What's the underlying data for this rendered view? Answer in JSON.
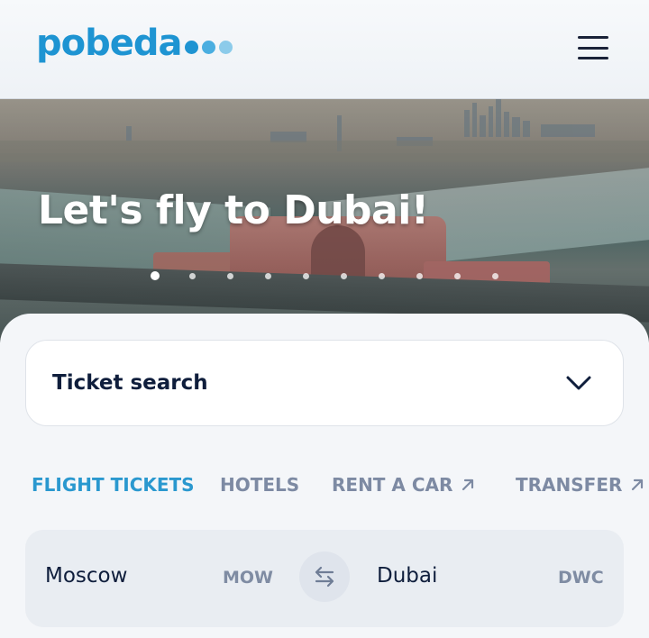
{
  "brand": {
    "name": "pobeda",
    "accent_color": "#1e94d2",
    "dot_colors": [
      "#1e94d2",
      "#4aaee0",
      "#8ccbea"
    ]
  },
  "header": {
    "menu_icon": "hamburger-menu-icon"
  },
  "hero": {
    "title": "Let's fly to Dubai!",
    "slide_count": 10,
    "active_slide": 1
  },
  "search": {
    "label": "Ticket search",
    "toggle_icon": "chevron-down-icon"
  },
  "tabs": [
    {
      "label": "FLIGHT TICKETS",
      "active": true
    },
    {
      "label": "HOTELS",
      "active": false
    },
    {
      "label": "RENT A CAR",
      "active": false,
      "icon": "arrow-up-right-icon"
    },
    {
      "label": "TRANSFER",
      "active": false,
      "icon": "arrow-up-right-icon"
    }
  ],
  "route": {
    "from_city": "Moscow",
    "from_code": "MOW",
    "to_city": "Dubai",
    "to_code": "DWC",
    "swap_icon": "swap-arrows-icon"
  },
  "colors": {
    "text_dark": "#0f1e3c",
    "tab_active": "#2a98cf",
    "tab_inactive": "#7d8aa3"
  }
}
